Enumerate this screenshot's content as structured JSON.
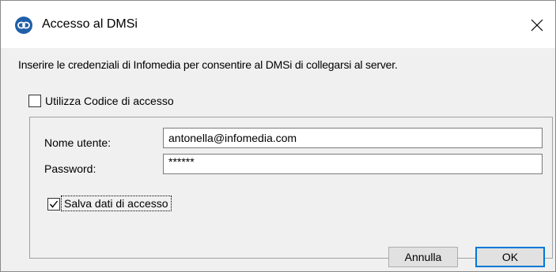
{
  "window": {
    "title": "Accesso al DMSi",
    "icon": "infomedia-link-icon",
    "close_icon": "close-icon"
  },
  "dialog": {
    "intro_text": "Inserire le credenziali di Infomedia per consentire al DMSi di collegarsi al server.",
    "use_code_label": "Utilizza Codice di accesso",
    "use_code_checked": false,
    "username_label": "Nome utente:",
    "username_value": "antonella@infomedia.com",
    "password_label": "Password:",
    "password_value": "******",
    "save_label": "Salva dati di accesso",
    "save_checked": true
  },
  "buttons": {
    "cancel_label": "Annulla",
    "ok_label": "OK"
  },
  "colors": {
    "client_bg": "#f0f0f0",
    "accent": "#0078d7",
    "icon_bg": "#1f5fa8"
  }
}
